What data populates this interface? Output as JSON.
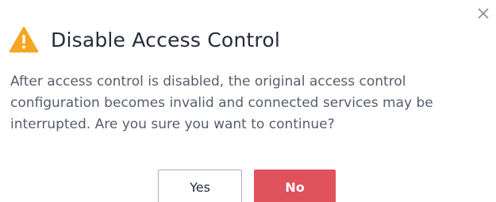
{
  "dialog": {
    "title": "Disable Access Control",
    "message": "After access control is disabled, the original access control configuration becomes invalid and connected services may be interrupted. Are you sure you want to continue?",
    "icon": "warning-icon",
    "close_icon": "close-icon",
    "buttons": {
      "yes_label": "Yes",
      "no_label": "No"
    }
  },
  "colors": {
    "warning": "#f66f6a",
    "danger_button": "#e0525c",
    "title_text": "#252b3a",
    "body_text": "#575d6c"
  }
}
